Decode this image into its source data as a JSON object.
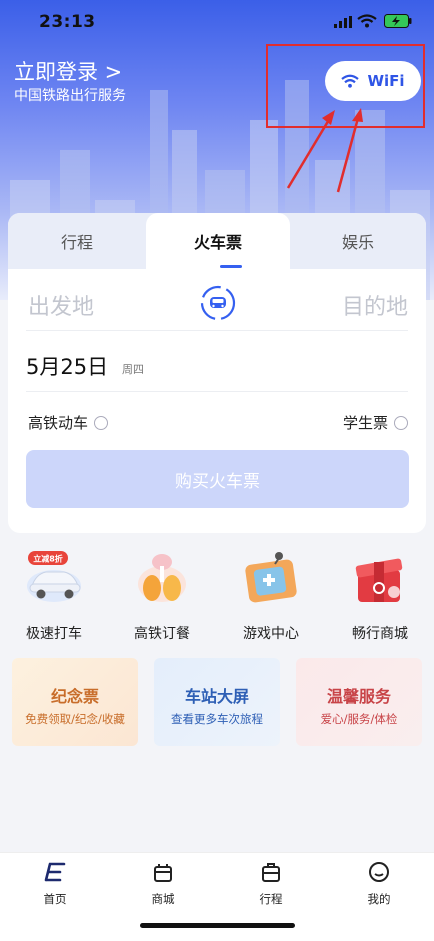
{
  "status": {
    "time": "23:13"
  },
  "header": {
    "login": "立即登录 >",
    "subtitle": "中国铁路出行服务",
    "wifi_label": "WiFi"
  },
  "booking": {
    "tabs": [
      "行程",
      "火车票",
      "娱乐"
    ],
    "active_tab": "火车票",
    "from_placeholder": "出发地",
    "to_placeholder": "目的地",
    "date": "5月25日",
    "weekday": "周四",
    "option_highspeed": "高铁动车",
    "option_student": "学生票",
    "buy_label": "购买火车票"
  },
  "services": [
    {
      "label": "极速打车",
      "icon": "car-icon",
      "badge": "立减8折"
    },
    {
      "label": "高铁订餐",
      "icon": "meal-icon"
    },
    {
      "label": "游戏中心",
      "icon": "game-icon"
    },
    {
      "label": "畅行商城",
      "icon": "gift-icon"
    }
  ],
  "promo_cards": [
    {
      "title": "纪念票",
      "subtitle": "免费领取/纪念/收藏"
    },
    {
      "title": "车站大屏",
      "subtitle": "查看更多车次旅程"
    },
    {
      "title": "温馨服务",
      "subtitle": "爱心/服务/体检"
    }
  ],
  "tabbar": [
    {
      "label": "首页",
      "icon": "home-icon"
    },
    {
      "label": "商城",
      "icon": "shop-icon"
    },
    {
      "label": "行程",
      "icon": "trip-icon"
    },
    {
      "label": "我的",
      "icon": "profile-icon"
    }
  ],
  "colors": {
    "brand": "#2f55e6",
    "highlight": "#e12d2d"
  }
}
